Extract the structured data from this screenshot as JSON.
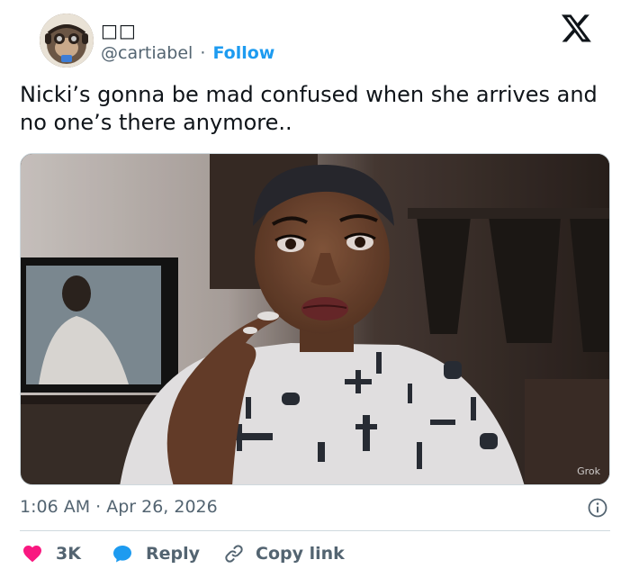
{
  "author": {
    "display_name": "□□",
    "handle": "@cartiabel",
    "separator": "·",
    "follow_label": "Follow"
  },
  "tweet": {
    "text": "Nicki’s gonna be mad confused when she arrives and no one’s there anymore..",
    "media_badge": "Grok",
    "timestamp": "1:06 AM · Apr 26, 2026"
  },
  "actions": {
    "like_count": "3K",
    "reply_label": "Reply",
    "copy_label": "Copy link"
  },
  "colors": {
    "accent": "#1d9bf0",
    "like": "#f91880",
    "text_primary": "#0f1419",
    "text_secondary": "#536471",
    "divider": "#cfd9de"
  },
  "icons": {
    "logo": "x-logo-icon",
    "info": "info-icon",
    "like": "heart-icon",
    "reply": "speech-bubble-icon",
    "copy": "link-icon"
  }
}
